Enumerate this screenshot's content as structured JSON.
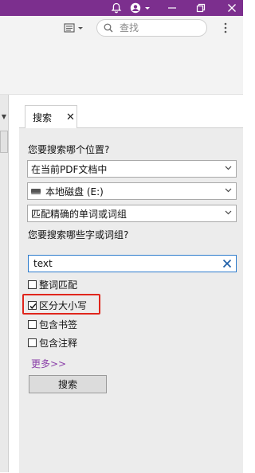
{
  "titlebar": {
    "icons": [
      "bell-icon",
      "account-icon",
      "minimize-icon",
      "restore-icon",
      "close-icon"
    ],
    "color": "#7c2f8e"
  },
  "toolbar": {
    "search_placeholder": "查找"
  },
  "panel": {
    "tab_label": "搜索",
    "where_label": "您要搜索哪个位置?",
    "location_select": "在当前PDF文档中",
    "drive_select": "本地磁盘 (E:)",
    "match_select": "匹配精确的单词或词组",
    "what_label": "您要搜索哪些字或词组?",
    "search_text": "text",
    "options": [
      {
        "label": "整词匹配",
        "checked": false
      },
      {
        "label": "区分大小写",
        "checked": true
      },
      {
        "label": "包含书签",
        "checked": false
      },
      {
        "label": "包含注释",
        "checked": false
      }
    ],
    "more_link": "更多>>",
    "search_button": "搜索"
  },
  "colors": {
    "accent": "#7c2f8e",
    "highlight": "#e0261c",
    "input_border": "#2c7bcc",
    "link": "#8a3fa8"
  }
}
